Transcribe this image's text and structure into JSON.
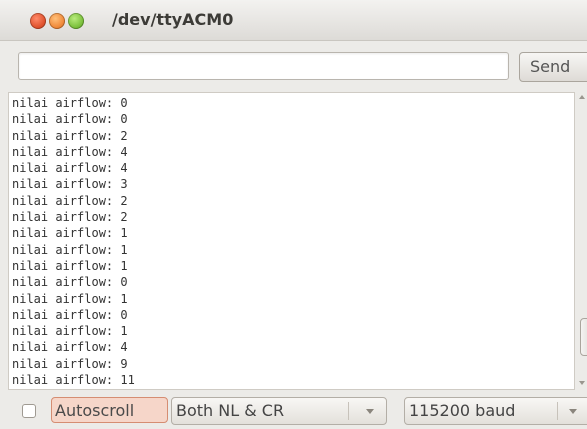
{
  "window": {
    "title": "/dev/ttyACM0"
  },
  "input": {
    "value": "",
    "send_label": "Send"
  },
  "output": {
    "lines": [
      "nilai airflow: 0",
      "nilai airflow: 0",
      "nilai airflow: 2",
      "nilai airflow: 4",
      "nilai airflow: 4",
      "nilai airflow: 3",
      "nilai airflow: 2",
      "nilai airflow: 2",
      "nilai airflow: 1",
      "nilai airflow: 1",
      "nilai airflow: 1",
      "nilai airflow: 0",
      "nilai airflow: 1",
      "nilai airflow: 0",
      "nilai airflow: 1",
      "nilai airflow: 4",
      "nilai airflow: 9",
      "nilai airflow: 11"
    ]
  },
  "footer": {
    "autoscroll_label": "Autoscroll",
    "autoscroll_checked": false,
    "line_ending": "Both NL & CR",
    "baud_rate": "115200 baud"
  },
  "colors": {
    "close_button": "#e0532e",
    "minimize_button": "#f08a3a",
    "maximize_button": "#7cc13d",
    "autoscroll_highlight": "#f6d6c9"
  },
  "icons": {
    "close": "close-icon",
    "minimize": "minimize-icon",
    "maximize": "maximize-icon",
    "dropdown": "chevron-down-icon"
  }
}
